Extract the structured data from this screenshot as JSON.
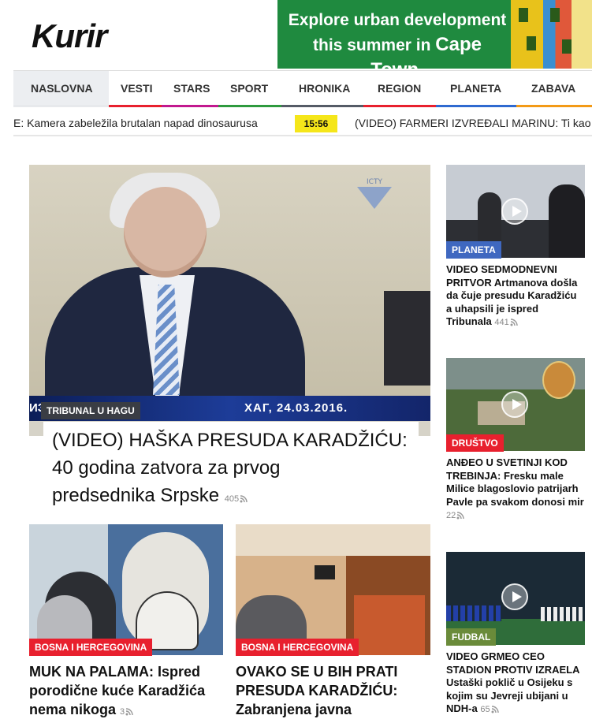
{
  "header": {
    "logo_text": "Kurir",
    "ad_line1": "Explore urban development",
    "ad_line2_prefix": "this summer in",
    "ad_line2_city": "Cape Town."
  },
  "nav": {
    "items": [
      {
        "label": "NASLOVNA",
        "color": "#e7e9ec"
      },
      {
        "label": "VESTI",
        "color": "#e8202e"
      },
      {
        "label": "STARS",
        "color": "#c2188f"
      },
      {
        "label": "SPORT",
        "color": "#2e9a3e"
      },
      {
        "label": "HRONIKA",
        "color": "#555b66"
      },
      {
        "label": "REGION",
        "color": "#e8202e"
      },
      {
        "label": "PLANETA",
        "color": "#2f6ad0"
      },
      {
        "label": "ZABAVA",
        "color": "#f39a16"
      }
    ]
  },
  "ticker": {
    "left_text": "E: Kamera zabeležila brutalan napad dinosaurusa",
    "time": "15:56",
    "right_text": "(VIDEO) FARMERI IZVREĐALI MARINU: Ti kao da"
  },
  "main_article": {
    "image_caption_left": "ИЗ УДЕ",
    "image_caption_right": "ХАГ, 24.03.2016.",
    "image_logo_text": "ICTY",
    "tag": "TRIBUNAL U HAGU",
    "title_line1": "(VIDEO) HAŠKA PRESUDA KARADŽIĆU:",
    "title_line2": "40 godina zatvora za prvog",
    "title_line3": "predsednika Srpske",
    "comments": "405"
  },
  "cards": [
    {
      "tag": "BOSNA I HERCEGOVINA",
      "title_line1": "MUK NA PALAMA: Ispred",
      "title_line2": "porodične kuće Karadžića",
      "title_line3": "nema nikoga",
      "comments": "3"
    },
    {
      "tag": "BOSNA I HERCEGOVINA",
      "title_line1": "OVAKO SE U BIH PRATI",
      "title_line2": "PRESUDA KARADŽIĆU:",
      "title_line3": "Zabranjena javna"
    }
  ],
  "sidebar": [
    {
      "tag": "PLANETA",
      "title": "VIDEO SEDMODNEVNI PRITVOR Artmanova došla da čuje presudu Karadžiću a uhapsili je ispred Tribunala",
      "comments": "441"
    },
    {
      "tag": "DRUŠTVO",
      "title": "ANĐEO U SVETINJI KOD TREBINJA: Fresku male Milice blagoslovio patrijarh Pavle pa svakom donosi mir",
      "comments": "22"
    },
    {
      "tag": "FUDBAL",
      "title": "VIDEO GRMEO CEO STADION PROTIV IZRAELA Ustaški poklič u Osijeku s kojim su Jevreji ubijani u NDH-a",
      "comments": "65"
    }
  ]
}
